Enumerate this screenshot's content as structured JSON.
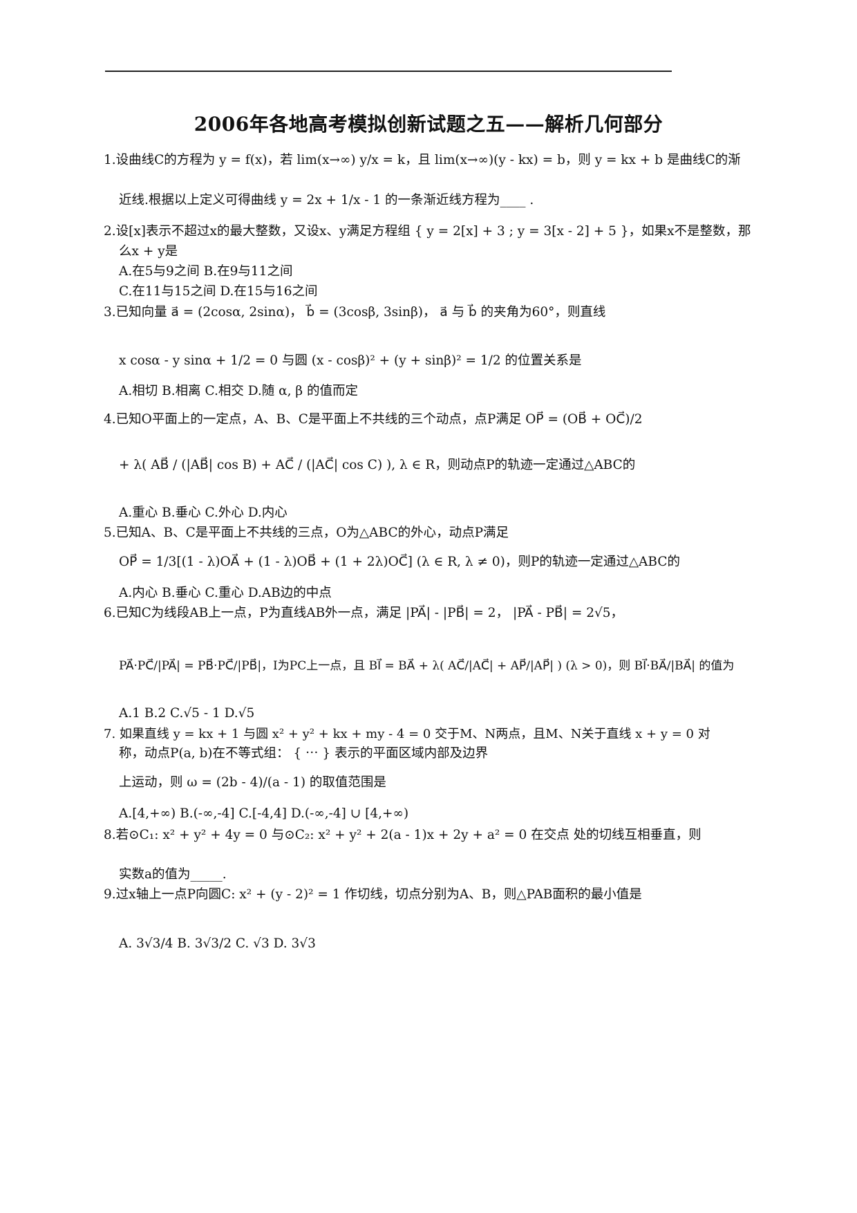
{
  "title": "2006年各地高考模拟创新试题之五——解析几何部分",
  "questions": [
    {
      "lines": [
        "1.设曲线C的方程为 y = f(x)，若 lim(x→∞) y/x = k，且 lim(x→∞)(y - kx) = b，则 y = kx + b 是曲线C的渐",
        "近线.根据以上定义可得曲线 y = 2x + 1/x - 1 的一条渐近线方程为____ ."
      ]
    },
    {
      "lines": [
        "2.设[x]表示不超过x的最大整数，又设x、y满足方程组 { y = 2[x] + 3 ; y = 3[x - 2] + 5 }，如果x不是整数，那",
        "么x + y是",
        "A.在5与9之间    B.在9与11之间",
        "C.在11与15之间  D.在15与16之间"
      ]
    },
    {
      "lines": [
        "3.已知向量 a⃗ = (2cosα, 2sinα)， b⃗ = (3cosβ, 3sinβ)， a⃗ 与 b⃗ 的夹角为60°，则直线",
        "x cosα - y sinα + 1/2 = 0 与圆 (x - cosβ)² + (y + sinβ)² = 1/2 的位置关系是",
        "A.相切   B.相离   C.相交   D.随 α, β 的值而定"
      ]
    },
    {
      "lines": [
        "4.已知O平面上的一定点，A、B、C是平面上不共线的三个动点，点P满足 OP⃗ = (OB⃗ + OC⃗)/2",
        "+ λ( AB⃗ / (|AB⃗| cos B) + AC⃗ / (|AC⃗| cos C) ), λ ∈ R，则动点P的轨迹一定通过△ABC的",
        "A.重心    B.垂心    C.外心    D.内心"
      ]
    },
    {
      "lines": [
        "5.已知A、B、C是平面上不共线的三点，O为△ABC的外心，动点P满足",
        "OP⃗ = 1/3[(1 - λ)OA⃗ + (1 - λ)OB⃗ + (1 + 2λ)OC⃗]  (λ ∈ R, λ ≠ 0)，则P的轨迹一定通过△ABC的",
        "A.内心    B.垂心    C.重心    D.AB边的中点"
      ]
    },
    {
      "lines": [
        "6.已知C为线段AB上一点，P为直线AB外一点，满足 |PA⃗| - |PB⃗| = 2， |PA⃗ - PB⃗| = 2√5，",
        "PA⃗·PC⃗/|PA⃗| = PB⃗·PC⃗/|PB⃗|，I为PC上一点，且 BI⃗ = BA⃗ + λ( AC⃗/|AC⃗| + AP⃗/|AP⃗| ) (λ > 0)，则 BI⃗·BA⃗/|BA⃗| 的值为",
        "A.1   B.2   C.√5 - 1   D.√5"
      ]
    },
    {
      "lines": [
        "7. 如果直线 y = kx + 1 与圆 x² + y² + kx + my - 4 = 0 交于M、N两点，且M、N关于直线 x + y = 0 对",
        "称，动点P(a, b)在不等式组： { ⋯ } 表示的平面区域内部及边界",
        "上运动，则 ω = (2b - 4)/(a - 1) 的取值范围是",
        "A.[4,+∞)    B.(-∞,-4]    C.[-4,4]    D.(-∞,-4] ∪ [4,+∞)"
      ]
    },
    {
      "lines": [
        "8.若⊙C₁: x² + y² + 4y = 0 与⊙C₂: x² + y² + 2(a - 1)x + 2y + a² = 0 在交点   处的切线互相垂直，则",
        "实数a的值为_____."
      ]
    },
    {
      "lines": [
        "9.过x轴上一点P向圆C: x² + (y - 2)² = 1 作切线，切点分别为A、B，则△PAB面积的最小值是",
        "A. 3√3/4    B. 3√3/2    C. √3    D. 3√3"
      ]
    }
  ]
}
